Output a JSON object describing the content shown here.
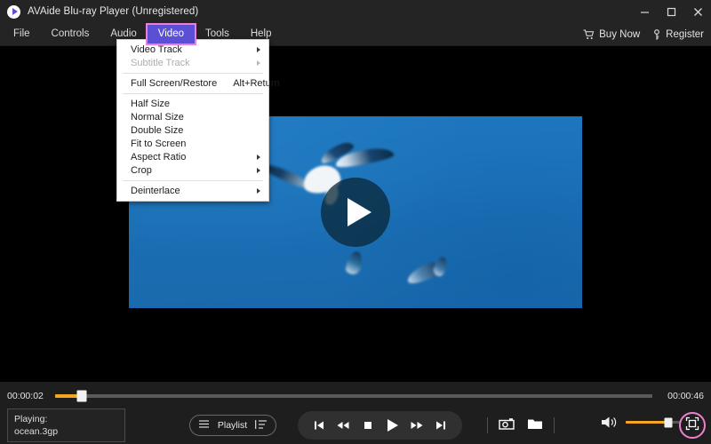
{
  "window": {
    "app_title": "AVAide Blu-ray Player (Unregistered)",
    "logo_icon": "play-circle-icon",
    "minimize_icon": "minimize-icon",
    "maximize_icon": "maximize-icon",
    "close_icon": "close-icon"
  },
  "menubar": {
    "items": [
      {
        "label": "File",
        "active": false
      },
      {
        "label": "Controls",
        "active": false
      },
      {
        "label": "Audio",
        "active": false
      },
      {
        "label": "Video",
        "active": true
      },
      {
        "label": "Tools",
        "active": false
      },
      {
        "label": "Help",
        "active": false
      }
    ],
    "buy_now": {
      "label": "Buy Now",
      "icon": "cart-icon"
    },
    "register": {
      "label": "Register",
      "icon": "key-icon"
    },
    "active_highlight_color": "#5b4fd6",
    "active_border_color": "#f07fd0"
  },
  "video_menu": {
    "items": [
      {
        "label": "Video Track",
        "shortcut": "",
        "submenu": true,
        "disabled": false,
        "separator_after": false
      },
      {
        "label": "Subtitle Track",
        "shortcut": "",
        "submenu": true,
        "disabled": true,
        "separator_after": true
      },
      {
        "label": "Full Screen/Restore",
        "shortcut": "Alt+Return",
        "submenu": false,
        "disabled": false,
        "separator_after": true
      },
      {
        "label": "Half Size",
        "shortcut": "",
        "submenu": false,
        "disabled": false,
        "separator_after": false
      },
      {
        "label": "Normal Size",
        "shortcut": "",
        "submenu": false,
        "disabled": false,
        "separator_after": false
      },
      {
        "label": "Double Size",
        "shortcut": "",
        "submenu": false,
        "disabled": false,
        "separator_after": false
      },
      {
        "label": "Fit to Screen",
        "shortcut": "",
        "submenu": false,
        "disabled": false,
        "separator_after": false
      },
      {
        "label": "Aspect Ratio",
        "shortcut": "",
        "submenu": true,
        "disabled": false,
        "separator_after": false
      },
      {
        "label": "Crop",
        "shortcut": "",
        "submenu": true,
        "disabled": false,
        "separator_after": true
      },
      {
        "label": "Deinterlace",
        "shortcut": "",
        "submenu": true,
        "disabled": false,
        "separator_after": false
      }
    ]
  },
  "stage": {
    "play_overlay_icon": "play-triangle-icon",
    "video_description": "seagulls flying against blue sky",
    "sky_color": "#1a6eb4"
  },
  "progress": {
    "elapsed": "00:00:02",
    "duration": "00:00:46",
    "percent": 4.5,
    "accent_color": "#f5a623"
  },
  "now_playing": {
    "status_label": "Playing:",
    "file_name": "ocean.3gp"
  },
  "playlist": {
    "label": "Playlist",
    "list_icon": "hamburger-list-icon",
    "sort_icon": "sort-list-icon"
  },
  "transport": {
    "buttons": [
      {
        "name": "previous-track-button",
        "icon": "skip-back-icon"
      },
      {
        "name": "rewind-button",
        "icon": "rewind-icon"
      },
      {
        "name": "stop-button",
        "icon": "stop-square-icon"
      },
      {
        "name": "play-button",
        "icon": "play-triangle-icon"
      },
      {
        "name": "fast-forward-button",
        "icon": "fast-forward-icon"
      },
      {
        "name": "next-track-button",
        "icon": "skip-forward-icon"
      }
    ]
  },
  "capture": {
    "snapshot_icon": "camera-icon",
    "open_folder_icon": "folder-icon"
  },
  "volume": {
    "icon": "speaker-volume-icon",
    "percent": 78,
    "accent_color": "#f5a623"
  },
  "fullscreen": {
    "icon": "fullscreen-expand-icon",
    "highlight_color": "#f07fd0"
  }
}
